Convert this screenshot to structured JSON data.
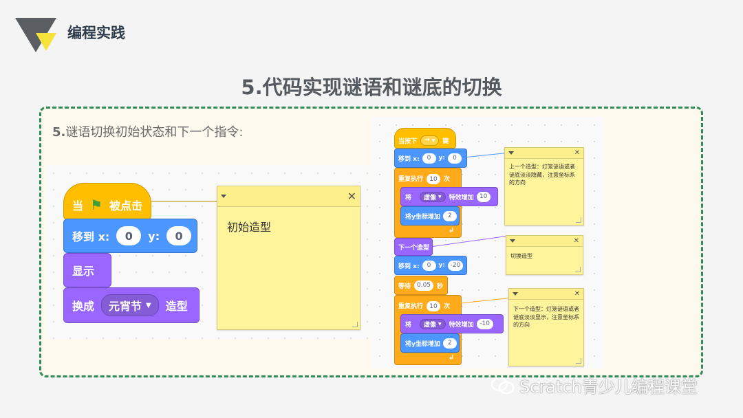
{
  "header": {
    "section_title": "编程实践"
  },
  "slide": {
    "title": "5.代码实现谜语和谜底的切换"
  },
  "instruction": {
    "number": "5.",
    "text": "谜语切换初始状态和下一个指令:"
  },
  "left_script": {
    "when_flag": {
      "when": "当",
      "clicked": "被点击"
    },
    "goto": {
      "label": "移到 x:",
      "x": "0",
      "y_label": "y:",
      "y": "0"
    },
    "show": "显示",
    "switch": {
      "label": "换成",
      "costume": "元宵节",
      "suffix": "造型"
    },
    "comment": "初始造型"
  },
  "right_script": {
    "when_key": {
      "label": "当按下",
      "key": "→",
      "suffix": "键"
    },
    "goto1": {
      "label": "移到 x:",
      "x": "0",
      "y_label": "y:",
      "y": "0"
    },
    "repeat1": {
      "label": "重复执行",
      "count": "10",
      "suffix": "次"
    },
    "effect1": {
      "label": "将",
      "effect": "虚像",
      "change": "特效增加",
      "value": "10"
    },
    "changey1": {
      "label": "将y坐标增加",
      "value": "2"
    },
    "next_costume": "下一个造型",
    "goto2": {
      "label": "移到 x:",
      "x": "0",
      "y_label": "y:",
      "y": "-20"
    },
    "wait": {
      "label": "等待",
      "value": "0.05",
      "suffix": "秒"
    },
    "repeat2": {
      "label": "重复执行",
      "count": "10",
      "suffix": "次"
    },
    "effect2": {
      "label": "将",
      "effect": "虚像",
      "change": "特效增加",
      "value": "-10"
    },
    "changey2": {
      "label": "将y坐标增加",
      "value": "2"
    },
    "comment1": "上一个造型：灯笼谜语或者谜底淡淡隐藏，注意坐标系的方向",
    "comment2": "切换造型",
    "comment3": "下一个造型：灯笼谜语或者谜底淡淡显示，注意坐标系的方向"
  },
  "watermark": {
    "text": "Scratch青少儿编程课堂"
  },
  "colors": {
    "event": "#ffbf00",
    "motion": "#4c97ff",
    "looks": "#9966ff",
    "control": "#ffab19",
    "comment": "#fef49c",
    "panel_border": "#2e8b57"
  }
}
